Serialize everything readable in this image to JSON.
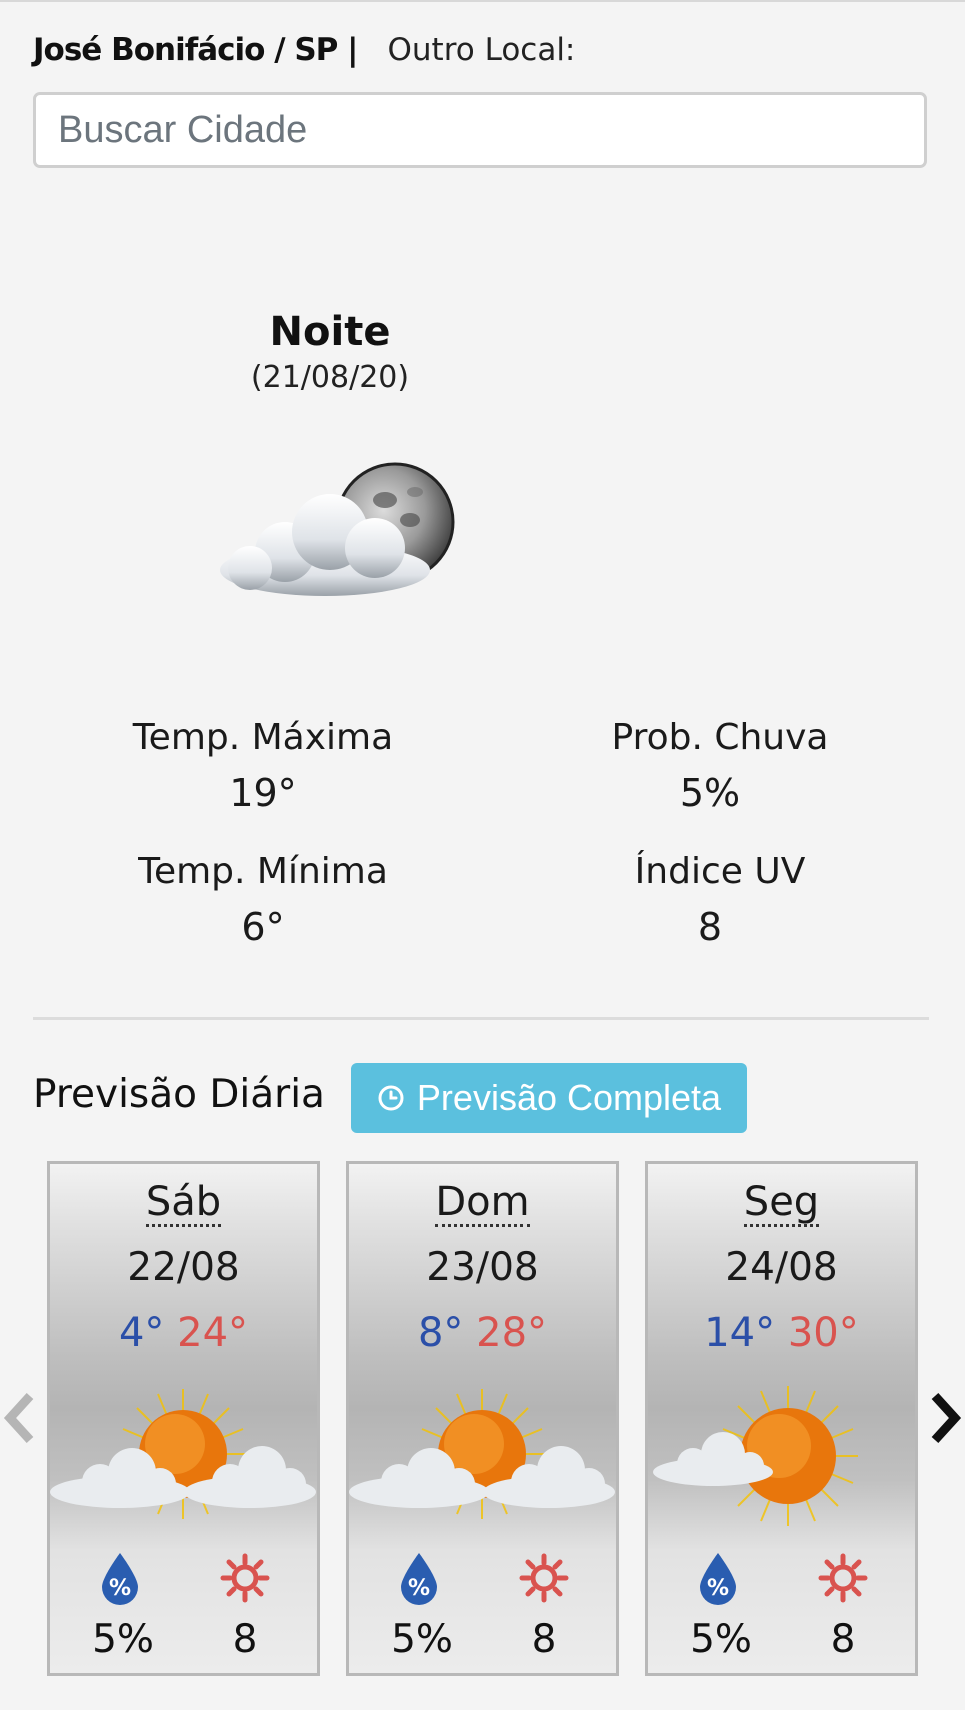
{
  "header": {
    "city": "José Bonifácio / SP |",
    "other_label": "Outro Local:"
  },
  "search": {
    "placeholder": "Buscar Cidade"
  },
  "current": {
    "period": "Noite",
    "date": "(21/08/20)",
    "icon": "cloud-moon-icon",
    "max_label": "Temp. Máxima",
    "max_value": "19°",
    "min_label": "Temp. Mínima",
    "min_value": "6°",
    "rain_label": "Prob. Chuva",
    "rain_value": "5%",
    "uv_label": "Índice UV",
    "uv_value": "8"
  },
  "daily": {
    "title": "Previsão Diária",
    "button_label": "Previsão Completa",
    "button_color": "#5bc0de",
    "min_color": "#2b4fa8",
    "max_color": "#d9534f",
    "days": [
      {
        "name": "Sáb",
        "date": "22/08",
        "min": "4°",
        "max": "24°",
        "icon": "partly-cloudy-sun-icon",
        "rain": "5%",
        "uv": "8"
      },
      {
        "name": "Dom",
        "date": "23/08",
        "min": "8°",
        "max": "28°",
        "icon": "partly-cloudy-sun-icon",
        "rain": "5%",
        "uv": "8"
      },
      {
        "name": "Seg",
        "date": "24/08",
        "min": "14°",
        "max": "30°",
        "icon": "sun-small-cloud-icon",
        "rain": "5%",
        "uv": "8"
      }
    ]
  },
  "nav": {
    "prev_icon": "chevron-left-icon",
    "next_icon": "chevron-right-icon"
  }
}
